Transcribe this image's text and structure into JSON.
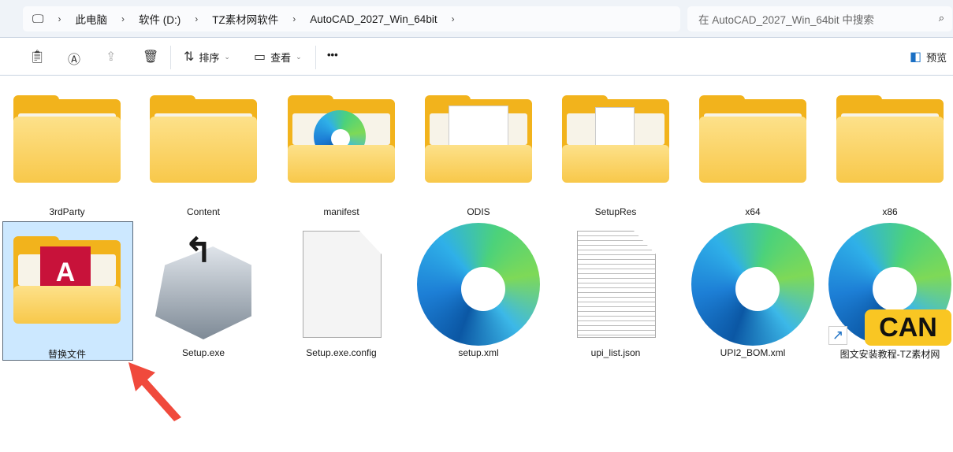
{
  "breadcrumb": [
    "此电脑",
    "软件 (D:)",
    "TZ素材网软件",
    "AutoCAD_2027_Win_64bit"
  ],
  "search": {
    "placeholder": "在 AutoCAD_2027_Win_64bit 中搜索"
  },
  "toolbar": {
    "sort": "排序",
    "view": "查看",
    "more": "•••",
    "preview": "预览"
  },
  "files": [
    {
      "name": "3rdParty",
      "type": "folder"
    },
    {
      "name": "Content",
      "type": "folder"
    },
    {
      "name": "manifest",
      "type": "folder"
    },
    {
      "name": "ODIS",
      "type": "folder"
    },
    {
      "name": "SetupRes",
      "type": "folder"
    },
    {
      "name": "x64",
      "type": "folder"
    },
    {
      "name": "x86",
      "type": "folder"
    },
    {
      "name": "替换文件",
      "type": "folder",
      "selected": true
    },
    {
      "name": "Setup.exe",
      "type": "exe"
    },
    {
      "name": "Setup.exe.config",
      "type": "file"
    },
    {
      "name": "setup.xml",
      "type": "edge"
    },
    {
      "name": "upi_list.json",
      "type": "text"
    },
    {
      "name": "UPI2_BOM.xml",
      "type": "edge"
    },
    {
      "name": "图文安装教程-TZ素材网",
      "type": "shortcut"
    }
  ],
  "watermark": "CAN",
  "colors": {
    "selection": "#cce8ff",
    "arrow": "#f04a3c",
    "folder": "#f8c84a"
  }
}
